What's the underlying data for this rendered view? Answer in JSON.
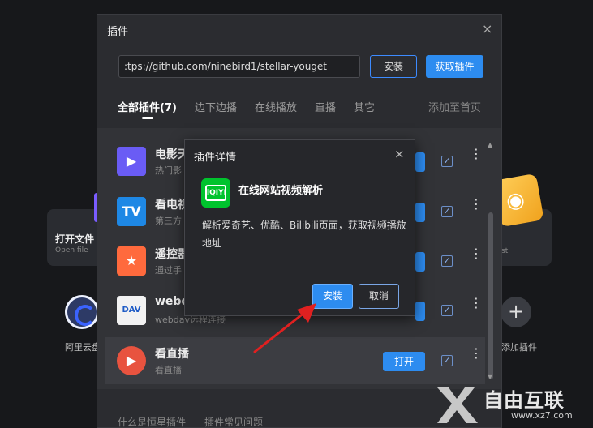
{
  "background": {
    "open_file_title": "打开文件",
    "open_file_sub": "Open file",
    "right_card_sub": "st",
    "cloud_label": "阿里云盘",
    "add_label": "添加插件",
    "add_symbol": "+"
  },
  "window": {
    "title": "插件",
    "close": "×",
    "url_value": ":tps://github.com/ninebird1/stellar-youget",
    "install_label": "安装",
    "get_plugins_label": "获取插件",
    "tabs": [
      {
        "label": "全部插件(7)"
      },
      {
        "label": "边下边播"
      },
      {
        "label": "在线播放"
      },
      {
        "label": "直播"
      },
      {
        "label": "其它"
      }
    ],
    "add_home_label": "添加至首页",
    "plugins": [
      {
        "name": "电影天",
        "sub": "热门影",
        "icon_text": "▶",
        "icon_color": "#6a5cf5",
        "button": ""
      },
      {
        "name": "看电视",
        "sub": "第三方",
        "icon_text": "TV",
        "icon_color": "#1e88e5",
        "button": ""
      },
      {
        "name": "遥控器",
        "sub": "通过手",
        "icon_text": "★",
        "icon_color": "#ff6a3d",
        "button": ""
      },
      {
        "name": "webd",
        "sub": "webdav远程连接",
        "icon_text": "DAV",
        "icon_color": "#f2f2f2",
        "button": ""
      },
      {
        "name": "看直播",
        "sub": "看直播",
        "icon_text": "▶",
        "icon_color": "#e8533f",
        "button": "打开"
      }
    ],
    "check_mark": "✓",
    "more_symbol": "⋮",
    "footer_links": [
      "什么是恒星插件",
      "插件常见问题"
    ]
  },
  "dialog": {
    "title": "插件详情",
    "close": "×",
    "logo_text": "iQIYI",
    "plugin_name": "在线网站视频解析",
    "description": "解析爱奇艺、优酷、Bilibili页面，获取视频播放地址",
    "install_label": "安装",
    "cancel_label": "取消"
  },
  "watermark": {
    "brand": "自由互联",
    "url": "www.xz7.com"
  },
  "colors": {
    "accent": "#2d8cf0",
    "arrow": "#e02020",
    "iqiyi": "#00c32d"
  }
}
